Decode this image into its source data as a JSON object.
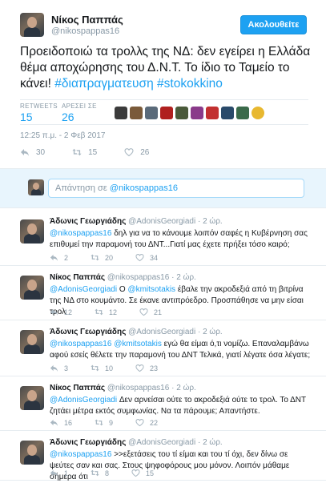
{
  "main": {
    "name": "Νίκος Παππάς",
    "handle": "@nikospappas16",
    "follow_label": "Ακολουθείτε",
    "text_plain": "Προειδοποιώ τα τρολλς της ΝΔ: δεν εγείρει η Ελλάδα θέμα αποχώρησης του Δ.Ν.Τ. Το ίδιο το Ταμείο το κάνει!",
    "hashtag1": "#διαπραγματευση",
    "hashtag2": "#stokokkino",
    "retweets_label": "RETWEETS",
    "retweets_value": "15",
    "likes_label": "ΑΡΕΣΕΙ ΣΕ",
    "likes_value": "26",
    "timestamp": "12:25 π.μ. - 2 Φεβ 2017",
    "reply_count": "30",
    "retweet_count": "15",
    "like_count": "26"
  },
  "reply_box": {
    "prefix": "Απάντηση σε ",
    "mention": "@nikospappas16"
  },
  "replies": [
    {
      "name": "Άδωνις Γεωργιάδης",
      "meta": "@AdonisGeorgiadi · 2 ώρ.",
      "mention": "@nikospappas16",
      "text": " δηλ για να το κάνουμε λοιπόν σαφές η Κυβέρνηση σας επιθυμεί την παραμονή του ΔΝΤ...Γιατί μας έχετε πρήξει τόσο καιρό;",
      "reply": "2",
      "retweet": "20",
      "like": "34"
    },
    {
      "name": "Νίκος Παππάς",
      "meta": "@nikospappas16 · 2 ώρ.",
      "mention": "@AdonisGeorgiadi",
      "text_a": " Ο ",
      "mention2": "@kmitsotakis",
      "text": " έβαλε την ακροδεξιά από τη βιτρίνα της ΝΔ στο κουμάντο. Σε έκανε αντιπρόεδρο. Προσπάθησε να μην είσαι τρολ",
      "reply": "12",
      "retweet": "12",
      "like": "21"
    },
    {
      "name": "Άδωνις Γεωργιάδης",
      "meta": "@AdonisGeorgiadi · 2 ώρ.",
      "mention": "@nikospappas16",
      "mention2": "@kmitsotakis",
      "text": " εγώ θα είμαι ό,τι νομίζω. Επαναλαμβάνω αφού εσείς θέλετε την παραμονή του ΔΝΤ Τελικά, γιατί λέγατε όσα λέγατε;",
      "reply": "3",
      "retweet": "10",
      "like": "23"
    },
    {
      "name": "Νίκος Παππάς",
      "meta": "@nikospappas16 · 2 ώρ.",
      "mention": "@AdonisGeorgiadi",
      "text": " Δεν αρνείσαι ούτε το ακροδεξιά ούτε το τρολ. Το ΔΝΤ ζητάει μέτρα εκτός συμφωνίας. Να τα πάρουμε; Απαντήστε.",
      "reply": "16",
      "retweet": "9",
      "like": "22"
    },
    {
      "name": "Άδωνις Γεωργιάδης",
      "meta": "@AdonisGeorgiadi · 2 ώρ.",
      "mention": "@nikospappas16",
      "text": " >>εξετάσεις του τί είμαι και του τί όχι, δεν δίνω σε ψεύτες σαν και σας. Στους ψηφοφόρους μου μόνον. Λοιπόν μάθαμε σήμερα ότι",
      "reply": "1",
      "retweet": "8",
      "like": "15"
    }
  ],
  "icons": {
    "reply": "reply-icon",
    "retweet": "retweet-icon",
    "like": "heart-icon"
  },
  "colors": {
    "accent": "#1da1f2",
    "muted": "#8899a6",
    "text": "#14171a"
  }
}
